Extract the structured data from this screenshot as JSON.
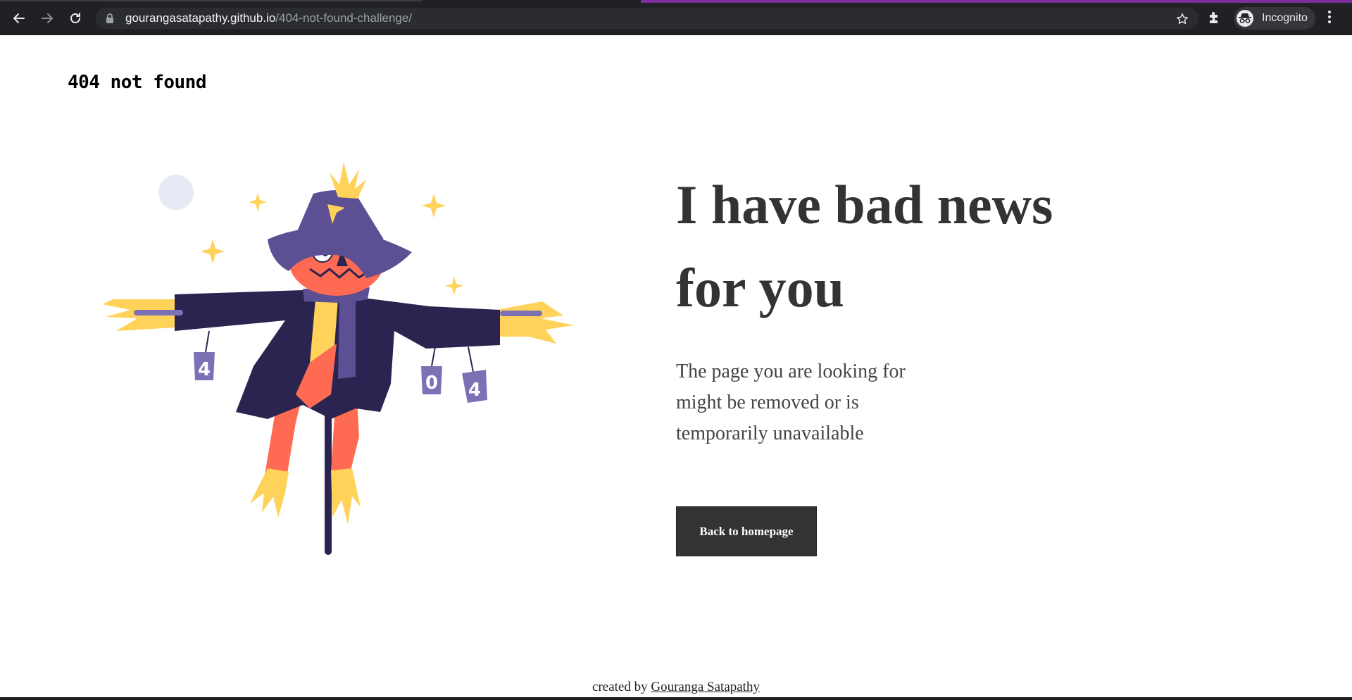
{
  "browser": {
    "url_host": "gourangasatapathy.github.io",
    "url_path": "/404-not-found-challenge/",
    "profile_label": "Incognito",
    "icons": [
      "back-icon",
      "forward-icon",
      "reload-icon",
      "lock-icon",
      "star-icon",
      "extensions-icon",
      "incognito-icon",
      "menu-icon"
    ]
  },
  "page": {
    "brand": "404 not found",
    "headline": "I have bad news for you",
    "subtext": "The page you are looking for might be removed or is temporarily unavailable",
    "button_label": "Back to homepage",
    "footer_prefix": "created by",
    "footer_author": "Gouranga Satapathy",
    "illustration_digits": [
      "4",
      "0",
      "4"
    ]
  },
  "colors": {
    "text_dark": "#333333",
    "button_bg": "#333333",
    "scarecrow_body": "#2b2450",
    "scarecrow_orange": "#ff6a52",
    "straw_yellow": "#ffd25a",
    "hat_purple": "#5c4f94",
    "can_purple": "#7d71b5"
  }
}
